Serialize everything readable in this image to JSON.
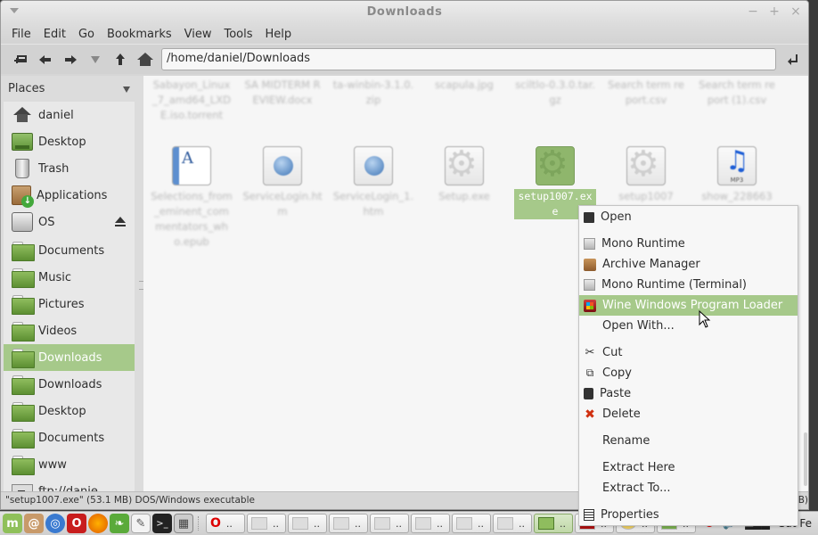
{
  "window": {
    "title": "Downloads",
    "controls": {
      "minimize": "−",
      "maximize": "+",
      "close": "×"
    }
  },
  "menubar": [
    "File",
    "Edit",
    "Go",
    "Bookmarks",
    "View",
    "Tools",
    "Help"
  ],
  "toolbar": {
    "buttons": [
      "new-tab-icon",
      "back-icon",
      "forward-icon",
      "history-dropdown-icon",
      "up-icon",
      "home-icon"
    ],
    "location": "/home/daniel/Downloads",
    "go_icon": "⮐"
  },
  "sidebar": {
    "header": "Places",
    "places": [
      {
        "label": "daniel",
        "icon": "home"
      },
      {
        "label": "Desktop",
        "icon": "desktop"
      },
      {
        "label": "Trash",
        "icon": "trash"
      },
      {
        "label": "Applications",
        "icon": "applications"
      },
      {
        "label": "OS",
        "icon": "drive",
        "eject": true
      }
    ],
    "bookmarks": [
      {
        "label": "Documents",
        "icon": "folder"
      },
      {
        "label": "Music",
        "icon": "folder"
      },
      {
        "label": "Pictures",
        "icon": "folder"
      },
      {
        "label": "Videos",
        "icon": "folder"
      },
      {
        "label": "Downloads",
        "icon": "folder",
        "selected": true
      },
      {
        "label": "Downloads",
        "icon": "folder"
      },
      {
        "label": "Desktop",
        "icon": "folder"
      },
      {
        "label": "Documents",
        "icon": "folder"
      },
      {
        "label": "www",
        "icon": "folder"
      },
      {
        "label": "ftp://danie...",
        "icon": "ftp"
      }
    ]
  },
  "files": {
    "row1": [
      {
        "name": "Sabayon_Linux_7_amd64_LXDE.iso.torrent"
      },
      {
        "name": "SA MIDTERM REVIEW.docx"
      },
      {
        "name": "ta-winbin-3.1.0.zip"
      },
      {
        "name": "scapula.jpg"
      },
      {
        "name": "sciltlo-0.3.0.tar.gz"
      },
      {
        "name": "Search term report.csv"
      },
      {
        "name": "Search term report (1).csv"
      }
    ],
    "row2": [
      {
        "name": "Selections_from_eminent_commentators_who.epub",
        "type": "epub"
      },
      {
        "name": "ServiceLogin.htm",
        "type": "html"
      },
      {
        "name": "ServiceLogin_1.htm",
        "type": "html"
      },
      {
        "name": "Setup.exe",
        "type": "exe"
      },
      {
        "name": "setup1007.exe",
        "type": "exe",
        "selected": true
      },
      {
        "name": "setup1007",
        "type": "exe"
      },
      {
        "name": "show_228663",
        "type": "mp3"
      }
    ]
  },
  "context_menu": {
    "items": [
      {
        "label": "Open",
        "icon": "open"
      },
      {
        "separator": true
      },
      {
        "label": "Mono Runtime",
        "icon": "mono"
      },
      {
        "label": "Archive Manager",
        "icon": "archive"
      },
      {
        "label": "Mono Runtime (Terminal)",
        "icon": "mono"
      },
      {
        "label": "Wine Windows Program Loader",
        "icon": "wine",
        "highlighted": true
      },
      {
        "label": "Open With...",
        "icon": ""
      },
      {
        "separator": true
      },
      {
        "label": "Cut",
        "icon": "cut"
      },
      {
        "label": "Copy",
        "icon": "copy"
      },
      {
        "label": "Paste",
        "icon": "paste"
      },
      {
        "label": "Delete",
        "icon": "delete"
      },
      {
        "separator": true
      },
      {
        "label": "Rename",
        "icon": ""
      },
      {
        "separator": true
      },
      {
        "label": "Extract Here",
        "icon": ""
      },
      {
        "label": "Extract To...",
        "icon": ""
      },
      {
        "separator": true
      },
      {
        "label": "Properties",
        "icon": "properties"
      }
    ]
  },
  "statusbar": {
    "text": "\"setup1007.exe\" (53.1 MB) DOS/Windows executable",
    "right": "GB)"
  },
  "taskbar": {
    "launchers": [
      "mint-menu",
      "files",
      "chromium",
      "opera",
      "firefox",
      "leafpad-green",
      "text-editor",
      "terminal",
      "calculator"
    ],
    "tasks": [
      {
        "icon": "opera",
        "label": ".."
      },
      {
        "icon": "window",
        "label": ".."
      },
      {
        "icon": "window",
        "label": ".."
      },
      {
        "icon": "editor",
        "label": ".."
      },
      {
        "icon": "window",
        "label": ".."
      },
      {
        "icon": "window",
        "label": ".."
      },
      {
        "icon": "window",
        "label": ".."
      },
      {
        "icon": "window",
        "label": ".."
      },
      {
        "icon": "file-manager",
        "label": "..",
        "active": true
      },
      {
        "icon": "filezilla",
        "label": ".."
      },
      {
        "icon": "smiley",
        "label": ".."
      },
      {
        "icon": "green-app",
        "label": ".."
      }
    ],
    "clock": "Sat Fe"
  }
}
